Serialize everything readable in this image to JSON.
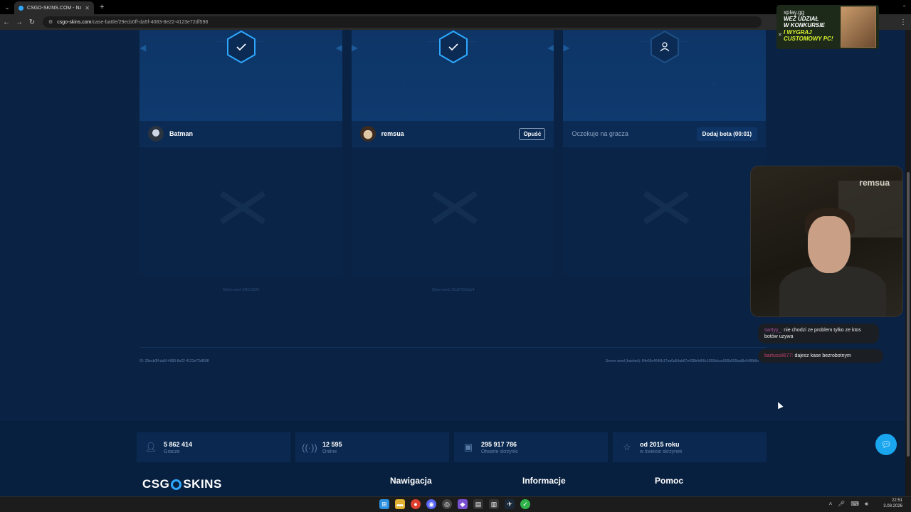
{
  "browser": {
    "tab_title": "CSGO-SKINS.COM - Najlepsze",
    "url_host": "csgo-skins.com",
    "url_path": "/case-battle/29ecb0ff-da5f-4083-8e22-4123e72df598"
  },
  "slots": [
    {
      "state": "ready",
      "icon": "check",
      "player": "Batman",
      "avatar": "batman",
      "action": "",
      "client_seed": "Client seed: 2f4219029"
    },
    {
      "state": "ready",
      "icon": "check",
      "player": "remsua",
      "avatar": "remsua",
      "action": "Opuść",
      "client_seed": "Client seed: 35a97f0b93a4"
    },
    {
      "state": "waiting",
      "icon": "user",
      "player": "",
      "waiting_text": "Oczekuje na gracza",
      "action": "Dodaj bota (00:01)",
      "client_seed": ""
    }
  ],
  "battle": {
    "id": "ID: 29ecb0ff-da5f-4083-8e22-4123e72df598",
    "server_seed": "Server seed (hashed): 84e59c4646b17ea0a54ab67e428b4d96c1055bfcce506b055baf8e049fb8e"
  },
  "stats": [
    {
      "value": "5 862 414",
      "label": "Gracze",
      "icon": "user-icon"
    },
    {
      "value": "12 595",
      "label": "Online",
      "icon": "broadcast-icon"
    },
    {
      "value": "295 917 786",
      "label": "Otwarte skrzynki",
      "icon": "box-icon"
    },
    {
      "value": "od 2015 roku",
      "label": "w świecie skrzynek",
      "icon": "star-icon"
    }
  ],
  "footer": {
    "brand_left": "CSG",
    "brand_right": "SKINS",
    "col1": "Nawigacja",
    "col2": "Informacje",
    "col3": "Pomoc"
  },
  "ad": {
    "brand": "xplay.gg",
    "line1": "WEŹ UDZIAŁ",
    "line2": "W KONKURSIE",
    "line3": "I WYGRAJ",
    "line4": "CUSTOMOWY PC!"
  },
  "webcam": {
    "logo": "remsua"
  },
  "chat": [
    {
      "user": "sw3yy_:",
      "text": "nie chodzi ze problem tylko ze ktos botów uzywa"
    },
    {
      "user": "bartuss8677:",
      "text": "dajesz kase bezrobotnym"
    }
  ],
  "clock": {
    "time": "22:51",
    "date": "3.08.2026"
  }
}
